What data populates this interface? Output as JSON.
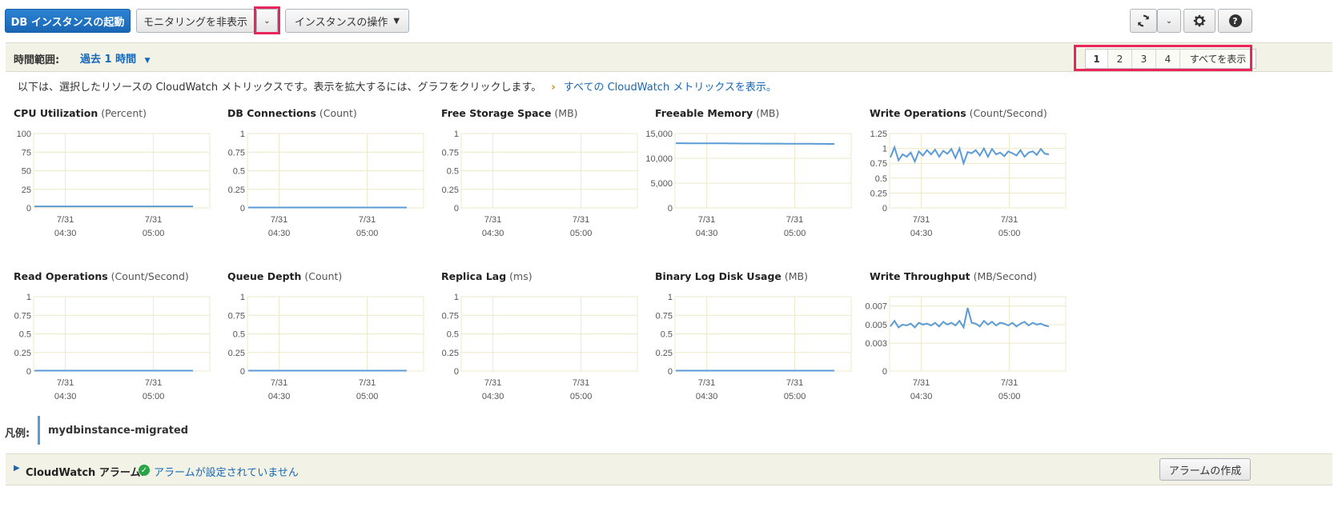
{
  "toolbar": {
    "launch_label": "DB インスタンスの起動",
    "monitoring_label": "モニタリングを非表示",
    "instance_actions_label": "インスタンスの操作"
  },
  "time_range": {
    "label": "時間範囲:",
    "value": "過去 1 時間"
  },
  "pager": {
    "pages": [
      "1",
      "2",
      "3",
      "4"
    ],
    "all_label": "すべてを表示",
    "active": "1"
  },
  "info": {
    "text": "以下は、選択したリソースの CloudWatch メトリックスです。表示を拡大するには、グラフをクリックします。",
    "link": "すべての CloudWatch メトリックスを表示。"
  },
  "charts": [
    {
      "title": "CPU Utilization",
      "unit": "(Percent)",
      "yticks": [
        "100",
        "75",
        "50",
        "25",
        "0"
      ]
    },
    {
      "title": "DB Connections",
      "unit": "(Count)",
      "yticks": [
        "1",
        "0.75",
        "0.5",
        "0.25",
        "0"
      ]
    },
    {
      "title": "Free Storage Space",
      "unit": "(MB)",
      "yticks": [
        "1",
        "0.75",
        "0.5",
        "0.25",
        "0"
      ]
    },
    {
      "title": "Freeable Memory",
      "unit": "(MB)",
      "yticks": [
        "15,000",
        "10,000",
        "5,000",
        "0"
      ]
    },
    {
      "title": "Write Operations",
      "unit": "(Count/Second)",
      "yticks": [
        "1.25",
        "1",
        "0.75",
        "0.5",
        "0.25",
        "0"
      ]
    },
    {
      "title": "Read Operations",
      "unit": "(Count/Second)",
      "yticks": [
        "1",
        "0.75",
        "0.5",
        "0.25",
        "0"
      ]
    },
    {
      "title": "Queue Depth",
      "unit": "(Count)",
      "yticks": [
        "1",
        "0.75",
        "0.5",
        "0.25",
        "0"
      ]
    },
    {
      "title": "Replica Lag",
      "unit": "(ms)",
      "yticks": [
        "1",
        "0.75",
        "0.5",
        "0.25",
        "0"
      ]
    },
    {
      "title": "Binary Log Disk Usage",
      "unit": "(MB)",
      "yticks": [
        "1",
        "0.75",
        "0.5",
        "0.25",
        "0"
      ]
    },
    {
      "title": "Write Throughput",
      "unit": "(MB/Second)",
      "yticks": [
        "0.007",
        "0.005",
        "0.003",
        "0"
      ]
    }
  ],
  "chart_data": [
    {
      "type": "line",
      "title": "CPU Utilization",
      "ylabel": "Percent",
      "ylim": [
        0,
        100
      ],
      "x": [
        "7/31 04:30",
        "7/31 05:00"
      ],
      "series": [
        {
          "values": [
            2,
            2,
            2,
            2,
            2,
            2,
            2,
            2,
            2,
            2,
            2,
            2,
            2,
            2,
            2,
            2,
            2,
            2,
            2,
            2,
            2,
            2,
            2,
            2,
            2,
            2,
            2,
            2,
            2,
            2
          ]
        }
      ]
    },
    {
      "type": "line",
      "title": "DB Connections",
      "ylabel": "Count",
      "ylim": [
        0,
        1
      ],
      "x": [
        "7/31 04:30",
        "7/31 05:00"
      ],
      "series": [
        {
          "values": [
            0,
            0,
            0,
            0,
            0,
            0,
            0,
            0,
            0,
            0,
            0,
            0,
            0,
            0,
            0,
            0,
            0,
            0,
            0,
            0,
            0,
            0,
            0,
            0,
            0,
            0,
            0,
            0,
            0,
            0
          ]
        }
      ]
    },
    {
      "type": "line",
      "title": "Free Storage Space",
      "ylabel": "MB",
      "ylim": [
        0,
        1
      ],
      "x": [
        "7/31 04:30",
        "7/31 05:00"
      ],
      "series": []
    },
    {
      "type": "line",
      "title": "Freeable Memory",
      "ylabel": "MB",
      "ylim": [
        0,
        15000
      ],
      "x": [
        "7/31 04:30",
        "7/31 05:00"
      ],
      "series": [
        {
          "values": [
            13050,
            13050,
            13040,
            13040,
            13030,
            13030,
            13020,
            13020,
            13010,
            13010,
            13000,
            13000,
            12990,
            12990,
            12980,
            12980,
            12970,
            12970,
            12960,
            12960,
            12950,
            12950,
            12940,
            12940,
            12930,
            12930,
            12920,
            12920,
            12910,
            12900
          ]
        }
      ]
    },
    {
      "type": "line",
      "title": "Write Operations",
      "ylabel": "Count/Second",
      "ylim": [
        0,
        1.25
      ],
      "x": [
        "7/31 04:30",
        "7/31 05:00"
      ],
      "series": [
        {
          "values": [
            0.85,
            1.02,
            0.8,
            0.9,
            0.86,
            0.93,
            0.78,
            0.95,
            0.88,
            0.97,
            0.9,
            0.98,
            0.86,
            0.96,
            0.91,
            0.99,
            0.84,
            1.0,
            0.75,
            0.94,
            0.92,
            0.97,
            0.88,
            1.0,
            0.86,
            0.99,
            0.9,
            0.93,
            0.87,
            0.95,
            0.92,
            0.88,
            0.97,
            0.86,
            0.93,
            0.95,
            0.89,
            0.99,
            0.91,
            0.9
          ]
        }
      ]
    },
    {
      "type": "line",
      "title": "Read Operations",
      "ylabel": "Count/Second",
      "ylim": [
        0,
        1
      ],
      "x": [
        "7/31 04:30",
        "7/31 05:00"
      ],
      "series": [
        {
          "values": [
            0,
            0,
            0,
            0,
            0,
            0,
            0,
            0,
            0,
            0,
            0,
            0,
            0,
            0,
            0,
            0,
            0,
            0,
            0,
            0,
            0,
            0,
            0,
            0,
            0,
            0,
            0,
            0,
            0,
            0
          ]
        }
      ]
    },
    {
      "type": "line",
      "title": "Queue Depth",
      "ylabel": "Count",
      "ylim": [
        0,
        1
      ],
      "x": [
        "7/31 04:30",
        "7/31 05:00"
      ],
      "series": [
        {
          "values": [
            0,
            0,
            0,
            0,
            0,
            0,
            0,
            0,
            0,
            0,
            0,
            0,
            0,
            0,
            0,
            0,
            0,
            0,
            0,
            0,
            0,
            0,
            0,
            0,
            0,
            0,
            0,
            0,
            0,
            0
          ]
        }
      ]
    },
    {
      "type": "line",
      "title": "Replica Lag",
      "ylabel": "ms",
      "ylim": [
        0,
        1
      ],
      "x": [
        "7/31 04:30",
        "7/31 05:00"
      ],
      "series": []
    },
    {
      "type": "line",
      "title": "Binary Log Disk Usage",
      "ylabel": "MB",
      "ylim": [
        0,
        1
      ],
      "x": [
        "7/31 04:30",
        "7/31 05:00"
      ],
      "series": [
        {
          "values": [
            0,
            0,
            0,
            0,
            0,
            0,
            0,
            0,
            0,
            0,
            0,
            0,
            0,
            0,
            0,
            0,
            0,
            0,
            0,
            0,
            0,
            0,
            0,
            0,
            0,
            0,
            0,
            0,
            0,
            0
          ]
        }
      ]
    },
    {
      "type": "line",
      "title": "Write Throughput",
      "ylabel": "MB/Second",
      "ylim": [
        0,
        0.008
      ],
      "x": [
        "7/31 04:30",
        "7/31 05:00"
      ],
      "series": [
        {
          "values": [
            0.0048,
            0.0054,
            0.0047,
            0.005,
            0.0049,
            0.0051,
            0.0047,
            0.0052,
            0.005,
            0.0051,
            0.0049,
            0.0052,
            0.0048,
            0.0053,
            0.005,
            0.0052,
            0.0049,
            0.0054,
            0.0047,
            0.0068,
            0.0052,
            0.0051,
            0.0048,
            0.0054,
            0.005,
            0.0053,
            0.0049,
            0.0052,
            0.0051,
            0.0049,
            0.0052,
            0.0048,
            0.0051,
            0.0053,
            0.0049,
            0.0052,
            0.005,
            0.0051,
            0.0049,
            0.0048
          ]
        }
      ]
    }
  ],
  "x_tick_labels": [
    [
      "7/31",
      "04:30"
    ],
    [
      "7/31",
      "05:00"
    ]
  ],
  "legend": {
    "label": "凡例:",
    "series_name": "mydbinstance-migrated",
    "color": "#5b9bd5"
  },
  "alarms": {
    "label": "CloudWatch アラーム:",
    "status": "アラームが設定されていません",
    "create_label": "アラームの作成"
  },
  "colors": {
    "accent": "#1a67b5",
    "highlight": "#e8265d",
    "line": "#5b9bd5"
  }
}
